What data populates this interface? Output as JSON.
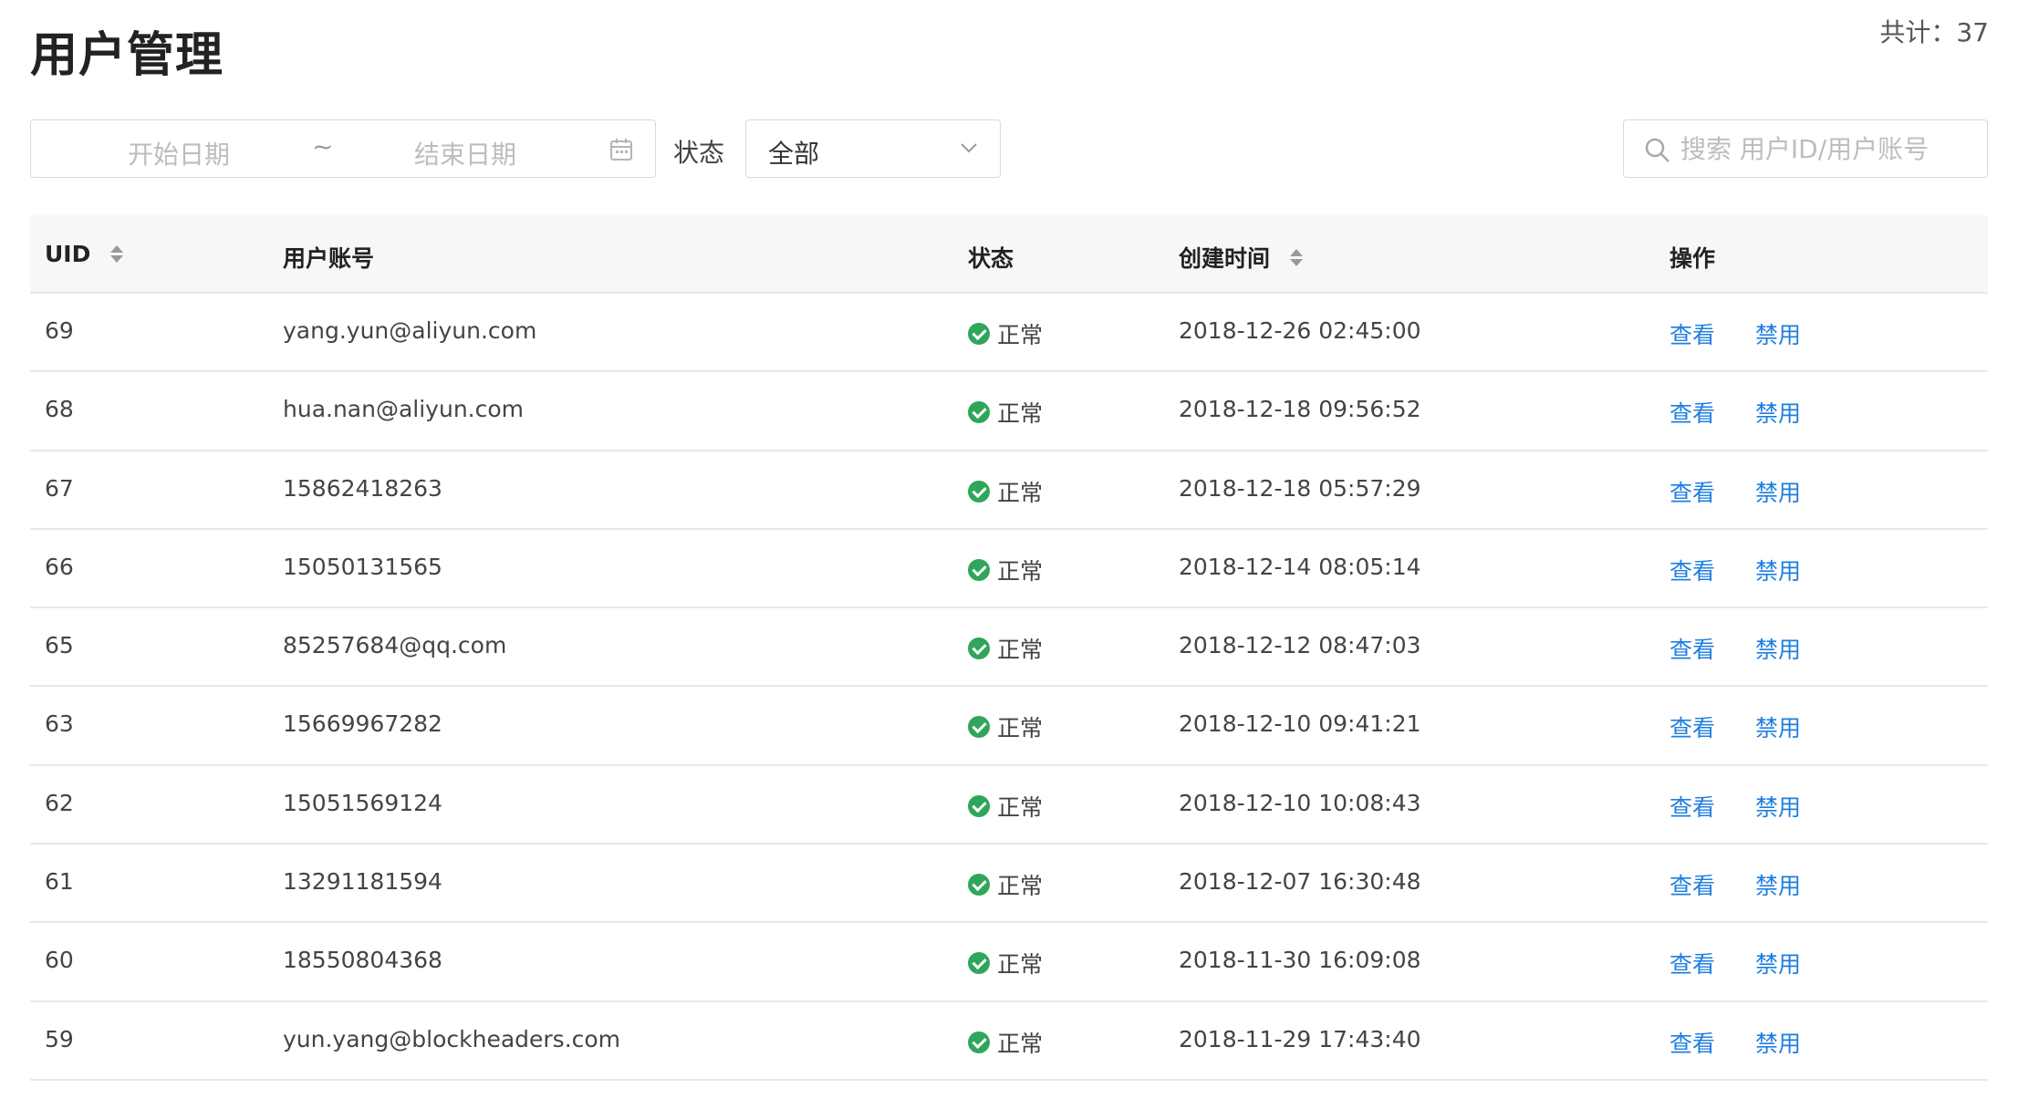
{
  "header": {
    "title": "用户管理",
    "total": "共计：37"
  },
  "filters": {
    "start_placeholder": "开始日期",
    "separator": "~",
    "end_placeholder": "结束日期",
    "status_label": "状态",
    "status_value": "全部",
    "search_placeholder": "搜索 用户ID/用户账号"
  },
  "table": {
    "columns": {
      "uid": "UID",
      "account": "用户账号",
      "status": "状态",
      "created": "创建时间",
      "actions": "操作"
    },
    "rows": [
      {
        "uid": "69",
        "account": "yang.yun@aliyun.com",
        "status": "正常",
        "created": "2018-12-26 02:45:00",
        "view": "查看",
        "ban": "禁用"
      },
      {
        "uid": "68",
        "account": "hua.nan@aliyun.com",
        "status": "正常",
        "created": "2018-12-18 09:56:52",
        "view": "查看",
        "ban": "禁用"
      },
      {
        "uid": "67",
        "account": "15862418263",
        "status": "正常",
        "created": "2018-12-18 05:57:29",
        "view": "查看",
        "ban": "禁用"
      },
      {
        "uid": "66",
        "account": "15050131565",
        "status": "正常",
        "created": "2018-12-14 08:05:14",
        "view": "查看",
        "ban": "禁用"
      },
      {
        "uid": "65",
        "account": "85257684@qq.com",
        "status": "正常",
        "created": "2018-12-12 08:47:03",
        "view": "查看",
        "ban": "禁用"
      },
      {
        "uid": "63",
        "account": "15669967282",
        "status": "正常",
        "created": "2018-12-10 09:41:21",
        "view": "查看",
        "ban": "禁用"
      },
      {
        "uid": "62",
        "account": "15051569124",
        "status": "正常",
        "created": "2018-12-10 10:08:43",
        "view": "查看",
        "ban": "禁用"
      },
      {
        "uid": "61",
        "account": "13291181594",
        "status": "正常",
        "created": "2018-12-07 16:30:48",
        "view": "查看",
        "ban": "禁用"
      },
      {
        "uid": "60",
        "account": "18550804368",
        "status": "正常",
        "created": "2018-11-30 16:09:08",
        "view": "查看",
        "ban": "禁用"
      },
      {
        "uid": "59",
        "account": "yun.yang@blockheaders.com",
        "status": "正常",
        "created": "2018-11-29 17:43:40",
        "view": "查看",
        "ban": "禁用"
      }
    ]
  },
  "icons": {
    "calendar": "calendar-icon",
    "chevron": "chevron-down-icon",
    "search": "search-icon",
    "status_ok": "check-circle-icon",
    "sort": "sort-icon"
  },
  "colors": {
    "link": "#1f7ee0",
    "status_ok": "#2fa65a"
  }
}
